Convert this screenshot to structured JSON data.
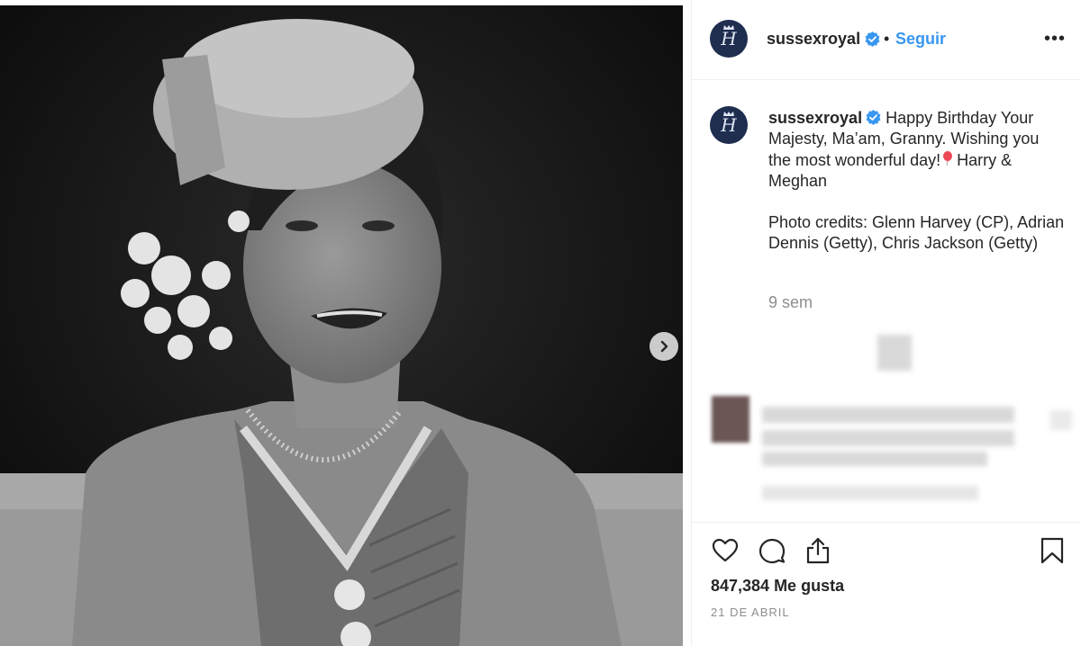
{
  "post": {
    "image_alt": "",
    "next_icon": "chevron-right-icon"
  },
  "header": {
    "username": "sussexroyal",
    "bullet": "•",
    "follow_label": "Seguir",
    "more_label": "•••"
  },
  "caption": {
    "username": "sussexroyal",
    "line1_before": "Happy Birthday Your Majesty, Ma’am, Granny. Wishing you the most wonderful day!",
    "line1_after": "Harry & Meghan",
    "line2": "Photo credits: Glenn Harvey (CP), Adrian Dennis (Getty), Chris Jackson (Getty)",
    "time": "9 sem"
  },
  "footer": {
    "likes": "847,384 Me gusta",
    "date": "21 DE ABRIL"
  },
  "colors": {
    "link": "#3897f0",
    "verified": "#3897f0",
    "avatar_bg": "#1f2d4f",
    "text": "#262626",
    "muted": "#8e8e8e",
    "balloon": "#ed4956"
  }
}
